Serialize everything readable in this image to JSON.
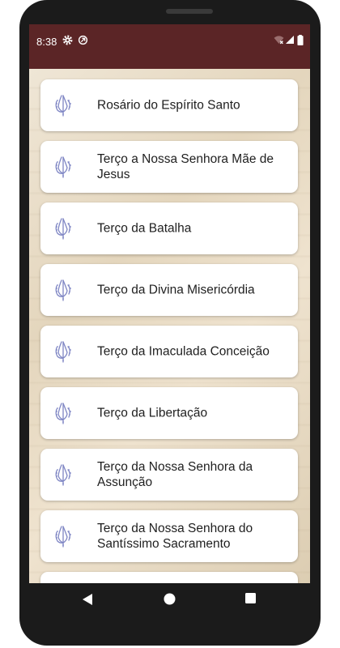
{
  "status_bar": {
    "time": "8:38",
    "icons": [
      "gear-icon",
      "sync-icon",
      "wifi-icon",
      "signal-icon",
      "battery-icon"
    ]
  },
  "list": {
    "items": [
      {
        "label": "Rosário do Espírito Santo",
        "icon": "praying-hands-rosary-icon"
      },
      {
        "label": "Terço a Nossa Senhora Mãe de Jesus",
        "icon": "praying-hands-rosary-icon"
      },
      {
        "label": "Terço da Batalha",
        "icon": "praying-hands-rosary-icon"
      },
      {
        "label": "Terço da Divina Misericórdia",
        "icon": "praying-hands-rosary-icon"
      },
      {
        "label": "Terço da Imaculada Conceição",
        "icon": "praying-hands-rosary-icon"
      },
      {
        "label": "Terço da Libertação",
        "icon": "praying-hands-rosary-icon"
      },
      {
        "label": "Terço da Nossa Senhora da Assunção",
        "icon": "praying-hands-rosary-icon"
      },
      {
        "label": "Terço da Nossa Senhora do Santíssimo Sacramento",
        "icon": "praying-hands-rosary-icon"
      }
    ]
  },
  "nav_bar": {
    "buttons": [
      "back-icon",
      "home-icon",
      "recents-icon"
    ]
  },
  "colors": {
    "status_bar": "#5b2526",
    "card": "#ffffff",
    "icon_stroke": "#7f86c4",
    "text": "#1f1f1f"
  }
}
